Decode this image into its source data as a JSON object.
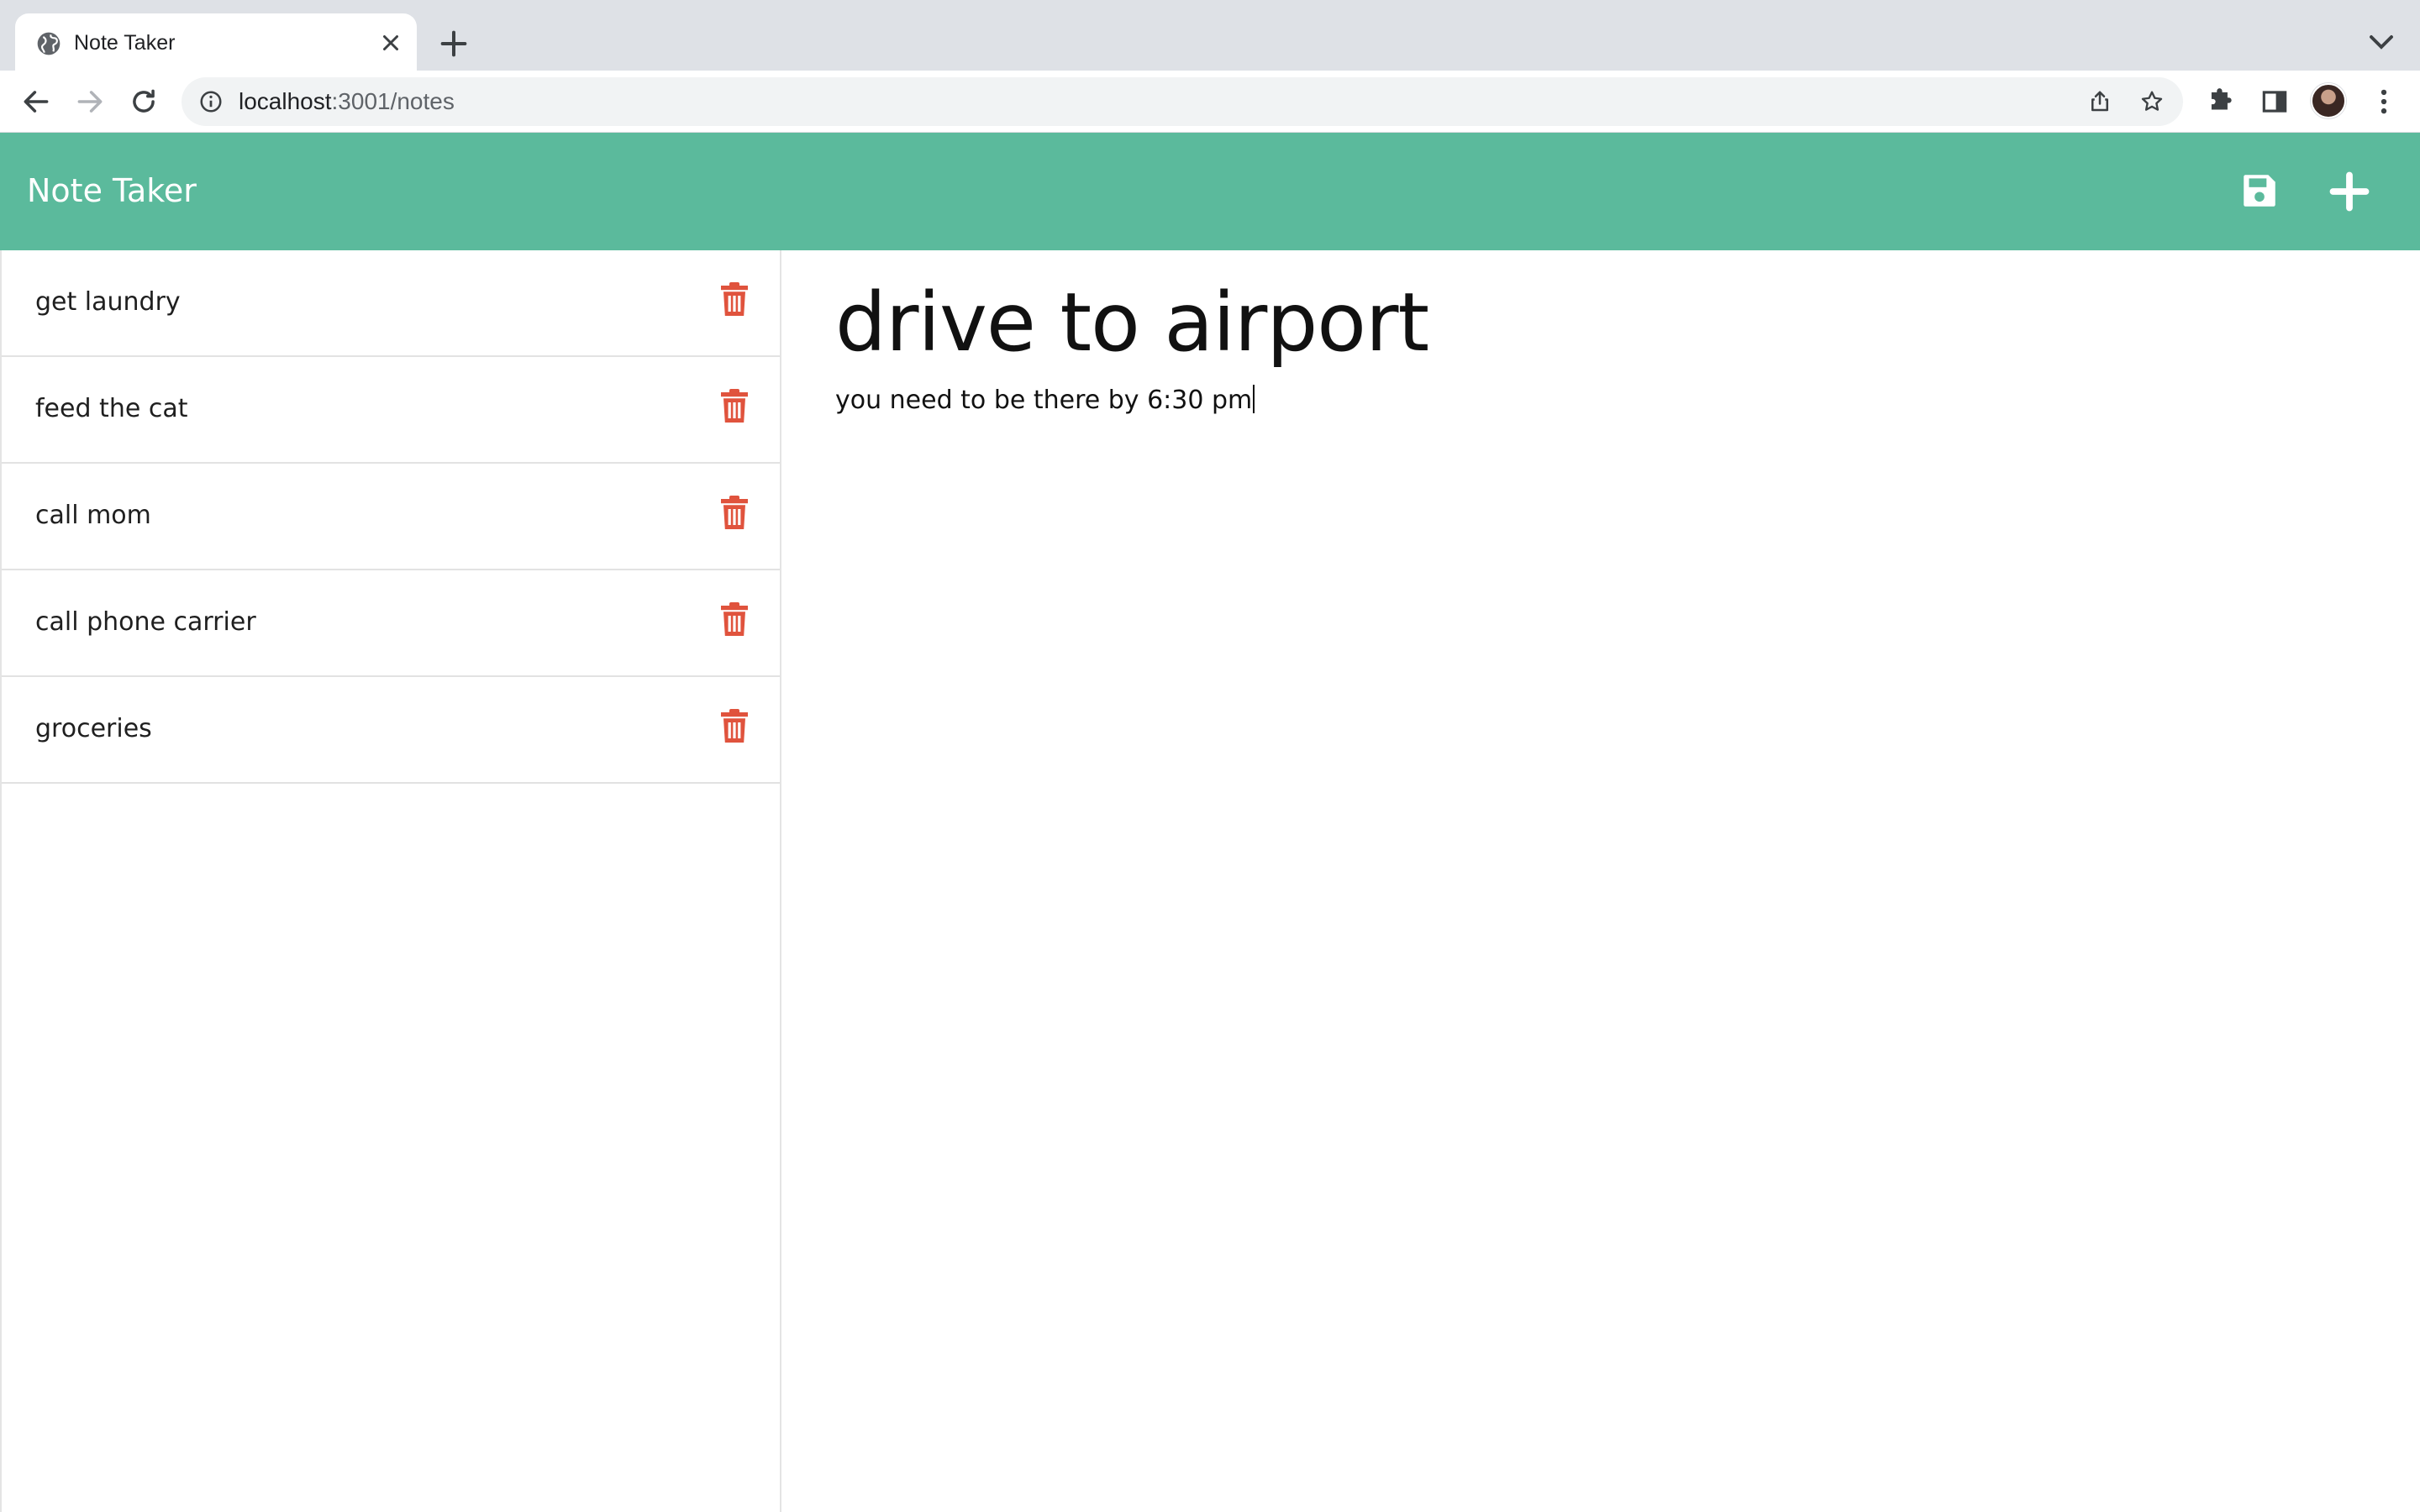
{
  "browser": {
    "tab_title": "Note Taker",
    "url_host": "localhost",
    "url_path": ":3001/notes"
  },
  "icons": {
    "favicon": "globe-icon",
    "tab_close": "close-icon",
    "new_tab": "plus-icon",
    "tab_search": "chevron-down-icon",
    "back": "arrow-left-icon",
    "forward": "arrow-right-icon",
    "reload": "reload-icon",
    "site_info": "info-icon",
    "share": "share-icon",
    "bookmark": "star-icon",
    "extensions": "puzzle-icon",
    "side_panel": "side-panel-icon",
    "menu": "kebab-menu-icon",
    "save": "floppy-disk-icon",
    "new_note": "plus-icon",
    "delete": "trash-icon"
  },
  "colors": {
    "header_bg": "#5bba9c",
    "trash": "#e0533d",
    "header_text": "#ffffff"
  },
  "app": {
    "title": "Note Taker"
  },
  "notes": [
    {
      "title": "get laundry"
    },
    {
      "title": "feed the cat"
    },
    {
      "title": "call mom"
    },
    {
      "title": "call phone carrier"
    },
    {
      "title": "groceries"
    }
  ],
  "active_note": {
    "title": "drive to airport",
    "text": "you need to be there by 6:30 pm"
  }
}
